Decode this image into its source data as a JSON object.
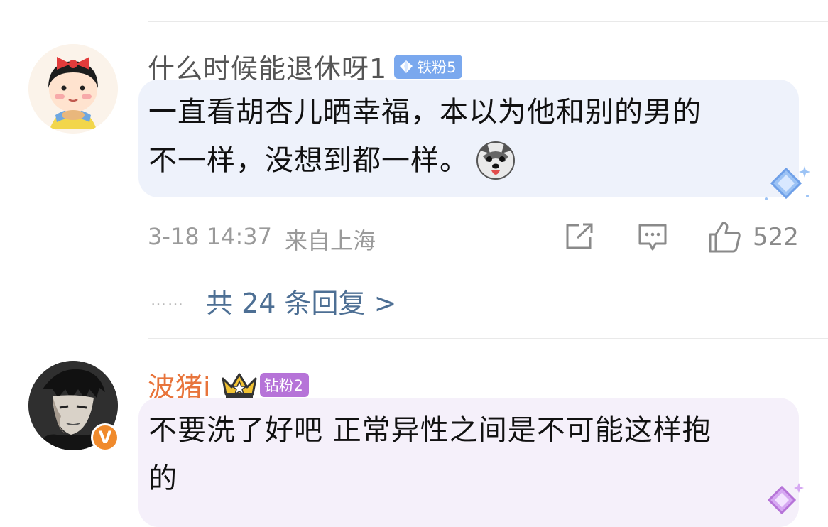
{
  "comments": [
    {
      "username": "什么时候能退休呀1",
      "badge": "铁粉5",
      "text_line1": "一直看胡杏儿晒幸福，本以为他和别的男的",
      "text_line2": "不一样，没想到都一样。",
      "emoji": "dog-face-emoji",
      "date": "3-18 14:37",
      "location": "来自上海",
      "likes": "522",
      "replies_link": "共 24 条回复 >",
      "colors": {
        "badge": "#7aa8ee",
        "bubble": "#eef2fb"
      }
    },
    {
      "username": "波猪i",
      "badge": "钻粉2",
      "text_line1": "不要洗了好吧 正常异性之间是不可能这样抱",
      "text_line2": "的",
      "verified": "V",
      "colors": {
        "username": "#e8743b",
        "badge": "#b673d8",
        "bubble": "#f5f0fa",
        "verified": "#f08a2c"
      }
    }
  ]
}
